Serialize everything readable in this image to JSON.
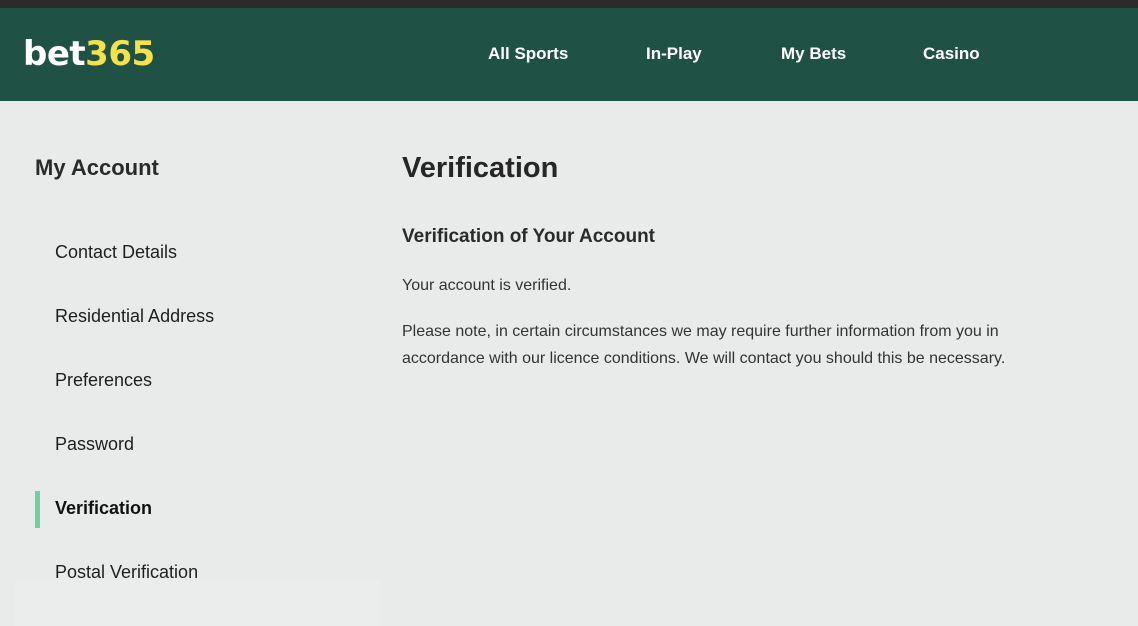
{
  "header": {
    "logo": {
      "part1": "bet",
      "part2": "365"
    },
    "nav": [
      {
        "label": "All Sports"
      },
      {
        "label": "In-Play"
      },
      {
        "label": "My Bets"
      },
      {
        "label": "Casino"
      }
    ]
  },
  "sidebar": {
    "title": "My Account",
    "items": [
      {
        "label": "Contact Details"
      },
      {
        "label": "Residential Address"
      },
      {
        "label": "Preferences"
      },
      {
        "label": "Password"
      },
      {
        "label": "Verification",
        "active": true
      },
      {
        "label": "Postal Verification"
      }
    ]
  },
  "main": {
    "title": "Verification",
    "section_heading": "Verification of Your Account",
    "status_text": "Your account is verified.",
    "note_text": "Please note, in certain circumstances we may require further information from you in accordance with our licence conditions. We will contact you should this be necessary."
  },
  "colors": {
    "header_bg": "#1f5245",
    "logo_accent": "#f5e14a",
    "active_indicator": "#6fd0a4",
    "page_bg": "#e9ebea"
  }
}
